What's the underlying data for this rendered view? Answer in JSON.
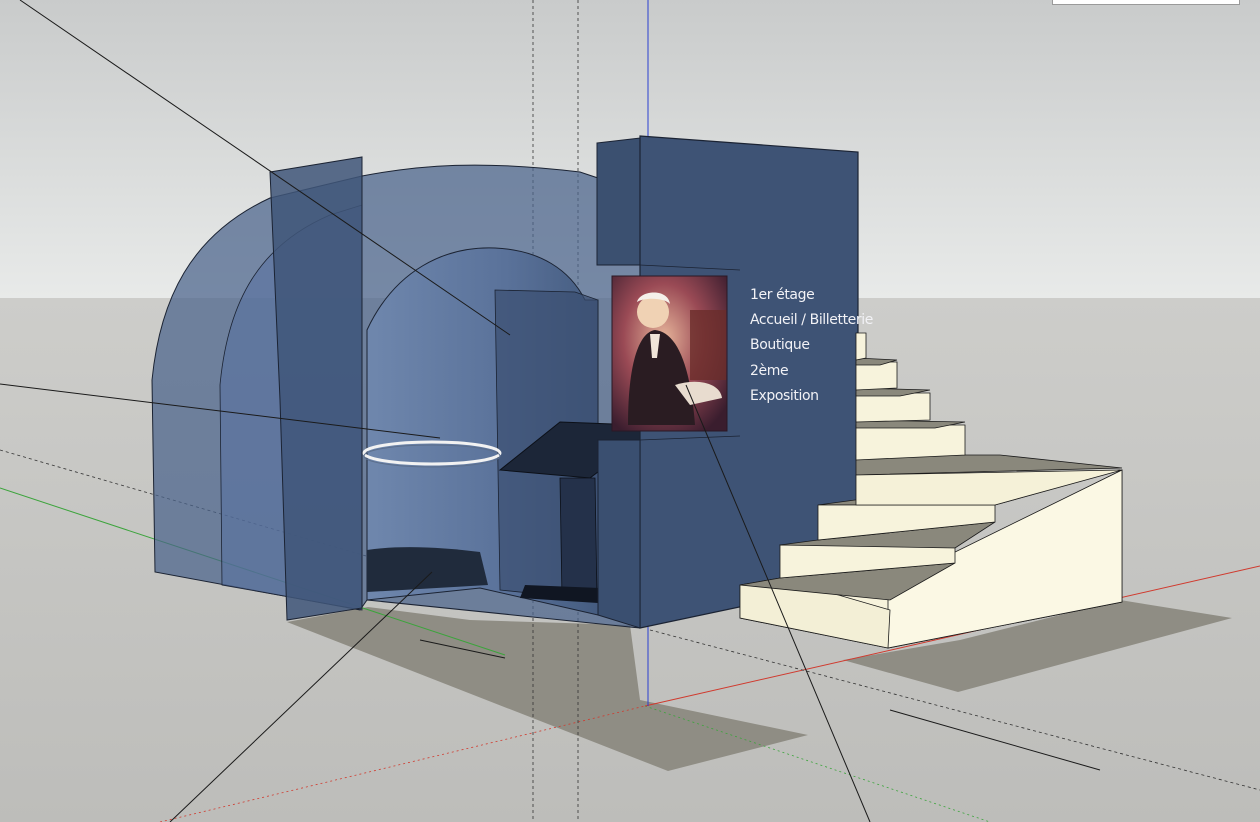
{
  "app": "3D modeling viewport",
  "model": {
    "sign": {
      "lines": [
        "1er étage",
        "Accueil / Billetterie",
        "Boutique",
        "2ème",
        "Exposition"
      ]
    }
  },
  "colors": {
    "sky_top": "#c9cbcb",
    "sky_bottom": "#e6e8e7",
    "ground": "#c6c6c3",
    "wall_blue": "#3e5375",
    "wall_blue_light": "#6a82a8",
    "stair_cream": "#f7f3dc",
    "stair_shadow": "#8a8a80",
    "axis_red": "#d03a2e",
    "axis_green": "#3ba43b",
    "axis_blue": "#2a3fd0"
  },
  "icons": {
    "portrait": "portrait-painting-icon"
  }
}
